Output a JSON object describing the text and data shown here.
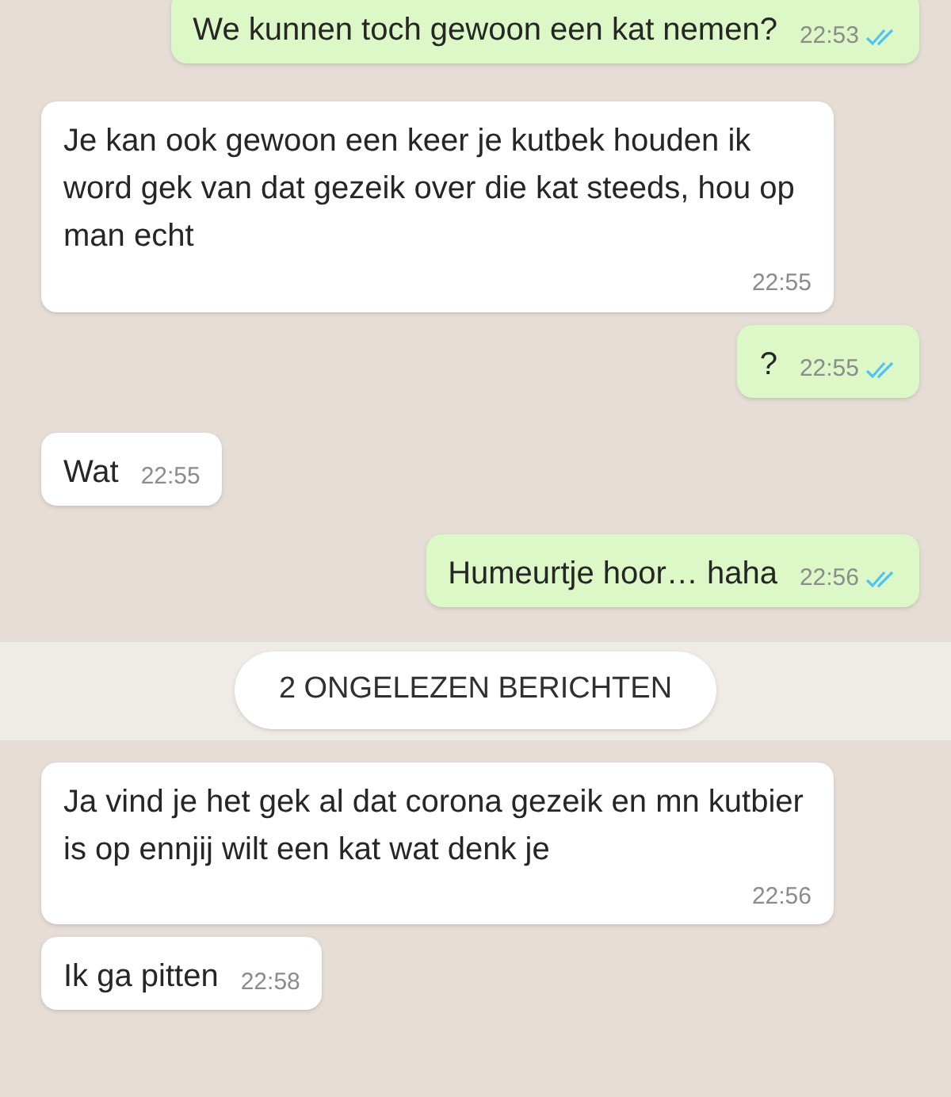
{
  "messages": [
    {
      "kind": "outgoing",
      "text": "We kunnen toch gewoon een kat nemen?",
      "time": "22:53",
      "read": true
    },
    {
      "kind": "incoming",
      "text": "Je kan ook gewoon een keer je kutbek houden ik word gek van dat gezeik over die kat steeds, hou op man echt",
      "time": "22:55"
    },
    {
      "kind": "outgoing",
      "text": "?",
      "time": "22:55",
      "read": true
    },
    {
      "kind": "incoming",
      "text": "Wat",
      "time": "22:55"
    },
    {
      "kind": "outgoing",
      "text": "Humeurtje hoor… haha",
      "time": "22:56",
      "read": true
    },
    {
      "kind": "unread",
      "text": "2 ONGELEZEN BERICHTEN"
    },
    {
      "kind": "incoming",
      "text": "Ja vind je het gek al dat corona gezeik en mn kutbier is op ennjij wilt een kat wat denk je",
      "time": "22:56"
    },
    {
      "kind": "incoming",
      "text": "Ik ga pitten",
      "time": "22:58"
    }
  ]
}
